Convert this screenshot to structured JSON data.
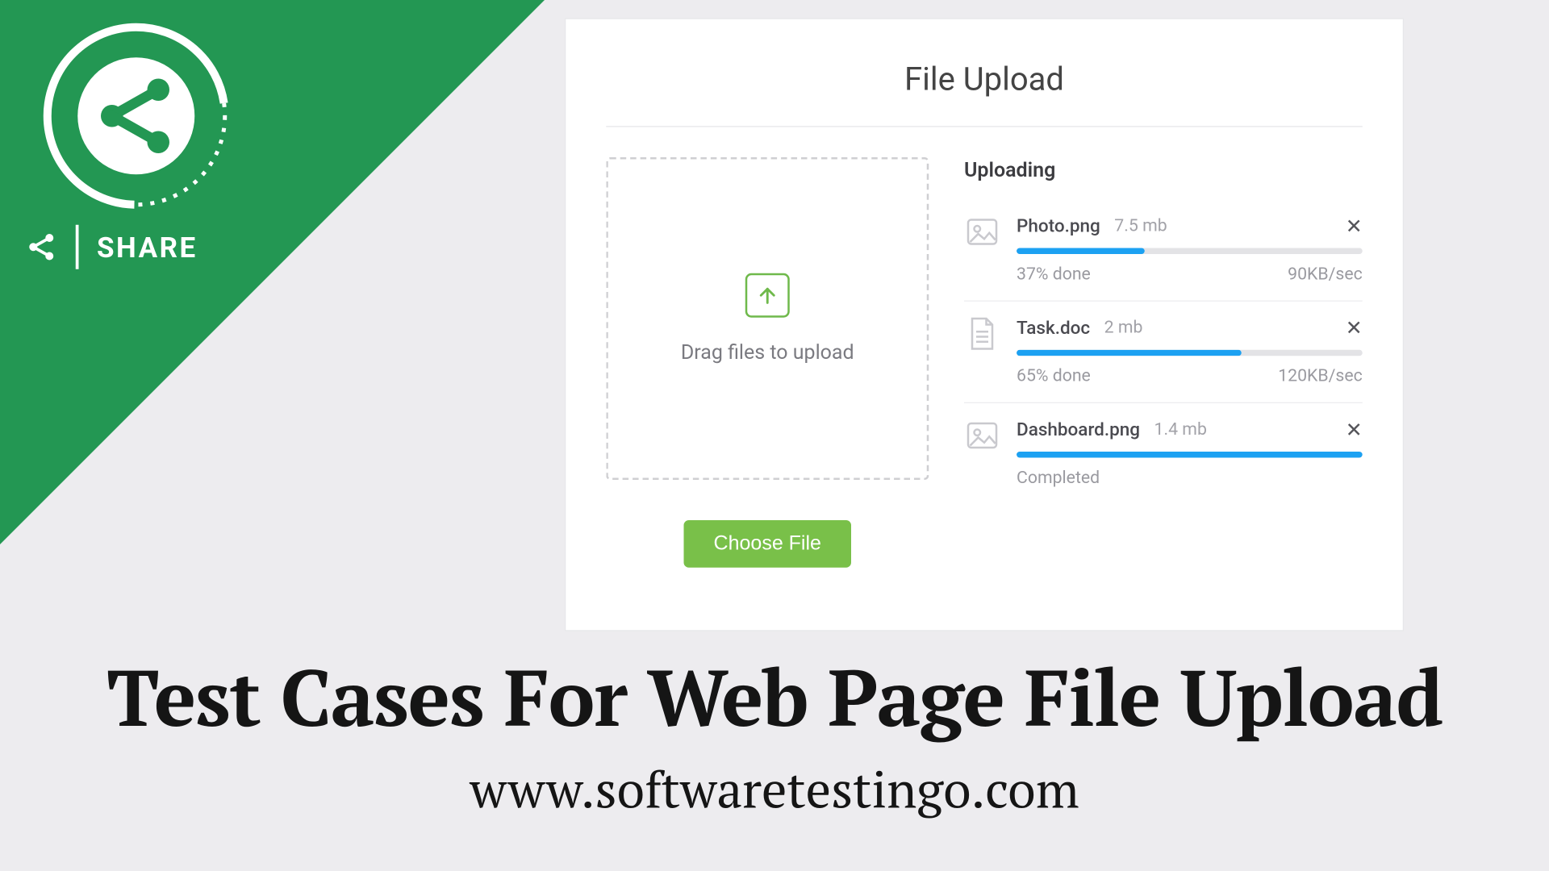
{
  "corner": {
    "share_label": "SHARE"
  },
  "card": {
    "title": "File Upload",
    "dropzone_text": "Drag files to upload",
    "choose_button": "Choose File",
    "uploading_label": "Uploading",
    "files": [
      {
        "icon": "image",
        "name": "Photo.png",
        "size": "7.5 mb",
        "progress": 37,
        "status_left": "37% done",
        "status_right": "90KB/sec",
        "complete": false
      },
      {
        "icon": "doc",
        "name": "Task.doc",
        "size": "2 mb",
        "progress": 65,
        "status_left": "65% done",
        "status_right": "120KB/sec",
        "complete": false
      },
      {
        "icon": "image",
        "name": "Dashboard.png",
        "size": "1.4 mb",
        "progress": 100,
        "status_left": "Completed",
        "status_right": "",
        "complete": true
      }
    ]
  },
  "headline": "Test Cases For Web Page File Upload",
  "url": "www.softwaretestingo.com",
  "colors": {
    "accent_green": "#239753",
    "button_green": "#79c049",
    "progress_blue": "#1ca1f2"
  }
}
